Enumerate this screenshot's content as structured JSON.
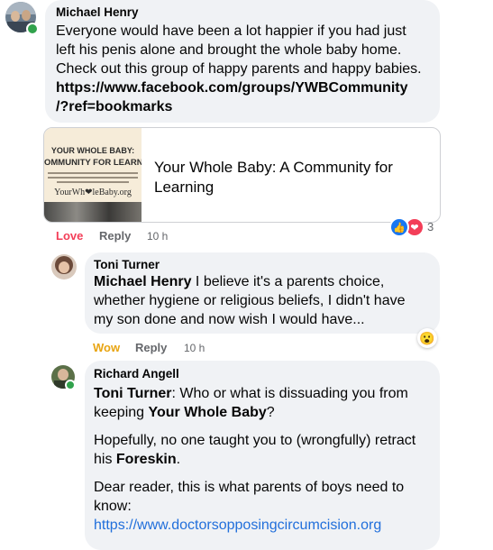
{
  "comment1": {
    "author": "Michael Henry",
    "text_line1": "Everyone would have been a lot happier if you had just",
    "text_line2": "left his penis alone and brought the whole baby home.",
    "text_line3": "Check out this group of happy parents and happy babies.",
    "link_line1": "https://www.facebook.com/groups/YWBCommunity",
    "link_line2": "/?ref=bookmarks",
    "preview": {
      "thumb_line1": "YOUR WHOLE BABY:",
      "thumb_line2": "OMMUNITY FOR LEARNI",
      "thumb_brand": "YourWh❤leBaby.org",
      "title_line1": "Your Whole Baby: A Community for",
      "title_line2": "Learning"
    },
    "actions": {
      "react": "Love",
      "reply": "Reply",
      "time": "10 h"
    },
    "reaction_count": "3"
  },
  "comment2": {
    "author": "Toni Turner",
    "mention": "Michael Henry",
    "text_line1_rest": " I believe it's a parents choice,",
    "text_line2": "whether hygiene or religious beliefs, I didn't have",
    "text_line3": "my son done and now wish I would have...",
    "reaction_emoji": "😮",
    "actions": {
      "react": "Wow",
      "reply": "Reply",
      "time": "10 h"
    }
  },
  "comment3": {
    "author": "Richard Angell",
    "mention": "Toni Turner",
    "p1_rest": ": Who or what is dissuading you from",
    "p1_line2_pre": "keeping ",
    "p1_bold": "Your Whole Baby",
    "p1_line2_post": "?",
    "p2_line1": "Hopefully, no one taught you to (wrongfully) retract",
    "p2_line2_pre": "his ",
    "p2_bold": "Foreskin",
    "p2_line2_post": ".",
    "p3_line1": "Dear reader, this is what parents of boys need to",
    "p3_line2": "know:",
    "link": "https://www.doctorsopposingcircumcision.org"
  },
  "colors": {
    "bubble": "#f0f2f5",
    "link": "#216fdb",
    "love": "#f33e58",
    "wow": "#f7b125",
    "muted": "#65676b"
  }
}
